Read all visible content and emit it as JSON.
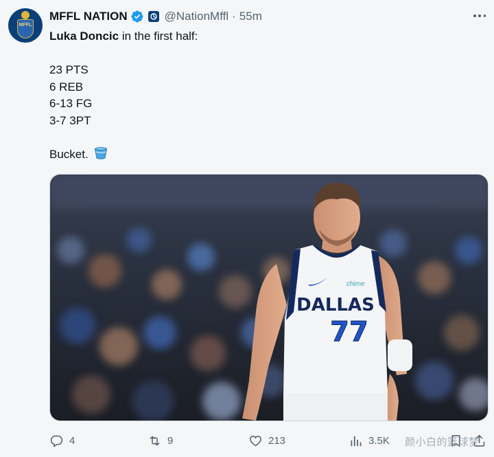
{
  "author": {
    "display_name": "MFFL NATION",
    "handle": "@NationMffl",
    "separator": "·",
    "time": "55m",
    "avatar_text": "MFFL",
    "verified_icon": "verified-badge-icon",
    "affiliate_icon": "affiliate-badge-icon"
  },
  "tweet": {
    "name_bold": "Luka Doncic",
    "intro_rest": " in the first half:",
    "stats": [
      "23 PTS",
      "6 REB",
      "6-13 FG",
      "3-7 3PT"
    ],
    "closing": "Bucket.",
    "closing_emoji": "bucket-emoji"
  },
  "media": {
    "jersey_team": "DALLAS",
    "jersey_number": "77",
    "jersey_sponsor": "chime"
  },
  "actions": {
    "replies": "4",
    "retweets": "9",
    "likes": "213",
    "views": "3.5K"
  },
  "watermark": "颜小白的篮球梦",
  "colors": {
    "accent": "#1d9bf0",
    "muted": "#536471",
    "text": "#0f1419",
    "navy": "#0b3f7a"
  }
}
